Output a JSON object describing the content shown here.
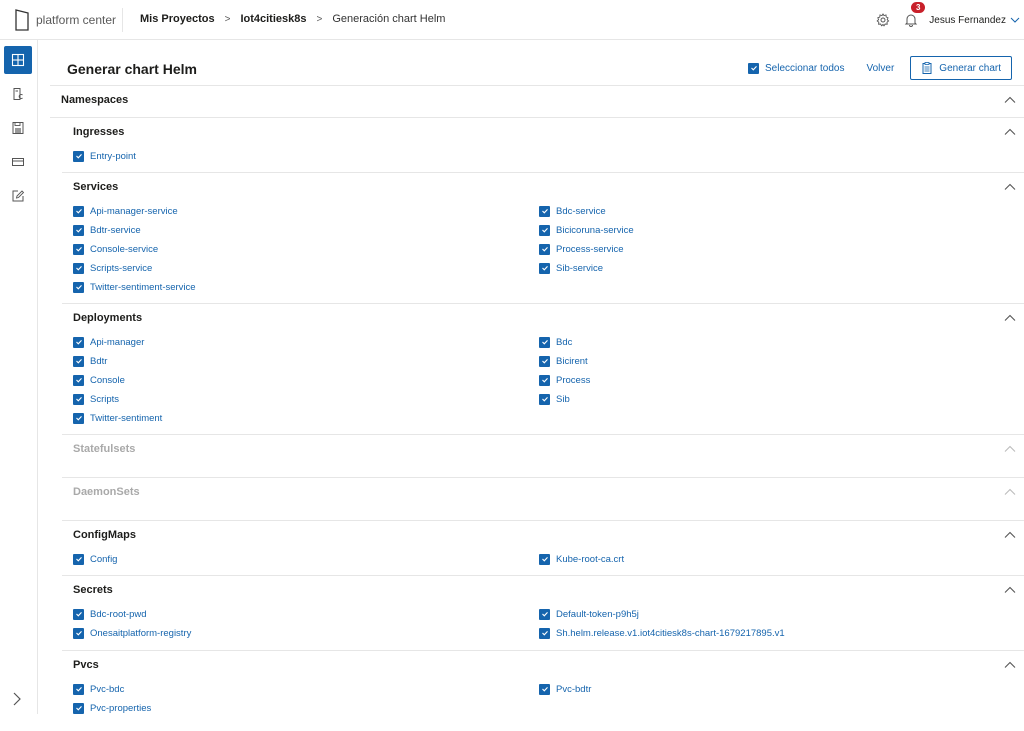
{
  "app": {
    "logo_text": "platform center"
  },
  "breadcrumb": [
    {
      "label": "Mis Proyectos"
    },
    {
      "label": "Iot4citiesk8s"
    },
    {
      "label": "Generación chart Helm"
    }
  ],
  "breadcrumb_separator": ">",
  "topbar": {
    "notifications_count": "3",
    "user_name": "Jesus Fernandez"
  },
  "sidebar": {
    "items": [
      {
        "icon": "grid-icon",
        "active": true
      },
      {
        "icon": "document-code-icon",
        "active": false
      },
      {
        "icon": "save-disk-icon",
        "active": false
      },
      {
        "icon": "card-icon",
        "active": false
      },
      {
        "icon": "edit-icon",
        "active": false
      }
    ],
    "expand_icon": "chevron-right-icon"
  },
  "page": {
    "title": "Generar chart Helm",
    "select_all_label": "Seleccionar todos",
    "select_all_checked": true,
    "back_label": "Volver",
    "generate_label": "Generar chart"
  },
  "namespace": {
    "title": "Namespaces"
  },
  "colors": {
    "accent": "#1564ad",
    "badge": "#c8202a",
    "disabled_text": "#a9a9a9",
    "divider": "#e6e6e6"
  },
  "sections": [
    {
      "title": "Ingresses",
      "disabled": false,
      "items": [
        "Entry-point"
      ]
    },
    {
      "title": "Services",
      "disabled": false,
      "items": [
        "Api-manager-service",
        "Bdc-service",
        "Bdtr-service",
        "Bicicoruna-service",
        "Console-service",
        "Process-service",
        "Scripts-service",
        "Sib-service",
        "Twitter-sentiment-service"
      ]
    },
    {
      "title": "Deployments",
      "disabled": false,
      "items": [
        "Api-manager",
        "Bdc",
        "Bdtr",
        "Bicirent",
        "Console",
        "Process",
        "Scripts",
        "Sib",
        "Twitter-sentiment"
      ]
    },
    {
      "title": "Statefulsets",
      "disabled": true,
      "items": []
    },
    {
      "title": "DaemonSets",
      "disabled": true,
      "items": []
    },
    {
      "title": "ConfigMaps",
      "disabled": false,
      "items": [
        "Config",
        "Kube-root-ca.crt"
      ]
    },
    {
      "title": "Secrets",
      "disabled": false,
      "items": [
        "Bdc-root-pwd",
        "Default-token-p9h5j",
        "Onesaitplatform-registry",
        "Sh.helm.release.v1.iot4citiesk8s-chart-1679217895.v1"
      ]
    },
    {
      "title": "Pvcs",
      "disabled": false,
      "items": [
        "Pvc-bdc",
        "Pvc-bdtr",
        "Pvc-properties"
      ]
    }
  ]
}
